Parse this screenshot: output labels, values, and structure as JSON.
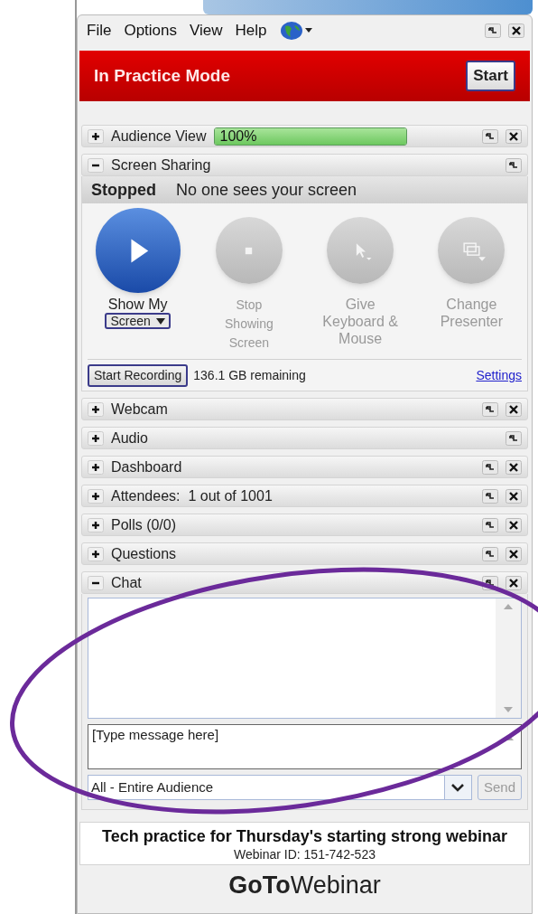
{
  "menu": [
    {
      "label": "File"
    },
    {
      "label": "Options"
    },
    {
      "label": "View"
    },
    {
      "label": "Help"
    }
  ],
  "banner": {
    "title": "In Practice Mode",
    "button": "Start"
  },
  "audience_view": {
    "label": "Audience View",
    "expanded": false,
    "closable": true,
    "level": 1,
    "reading": "100%"
  },
  "screen_sharing": {
    "label": "Screen Sharing",
    "expanded": true,
    "closable": false,
    "status": "Stopped",
    "status_text": "No one sees your screen",
    "actions": [
      {
        "kind": "play",
        "label": "Show My",
        "dropdown": "Screen",
        "enabled": true
      },
      {
        "kind": "stop",
        "label": "Stop Showing Screen",
        "enabled": false
      },
      {
        "kind": "pointer",
        "label": "Give Keyboard & Mouse",
        "enabled": false
      },
      {
        "kind": "monitors",
        "label": "Change Presenter",
        "enabled": false
      }
    ],
    "record_button": "Start Recording",
    "remaining": "136.1 GB remaining",
    "settings_link": "Settings"
  },
  "panels": [
    {
      "label": "Webcam",
      "expanded": false,
      "closable": true
    },
    {
      "label": "Audio",
      "expanded": false,
      "closable": false
    },
    {
      "label": "Dashboard",
      "expanded": false,
      "closable": true
    },
    {
      "label": "Attendees:  1 out of 1001",
      "expanded": false,
      "closable": true
    },
    {
      "label": "Polls (0/0)",
      "expanded": false,
      "closable": true
    },
    {
      "label": "Questions",
      "expanded": false,
      "closable": true
    }
  ],
  "chat": {
    "label": "Chat",
    "expanded": true,
    "closable": true,
    "message_placeholder": "[Type message here]",
    "recipient": "All - Entire Audience",
    "send_button": "Send",
    "send_disabled": true
  },
  "footer": {
    "title": "Tech practice for Thursday's starting strong webinar",
    "webinar_id": "Webinar ID: 151-742-523",
    "logo": "**GoTo**Webinar"
  }
}
